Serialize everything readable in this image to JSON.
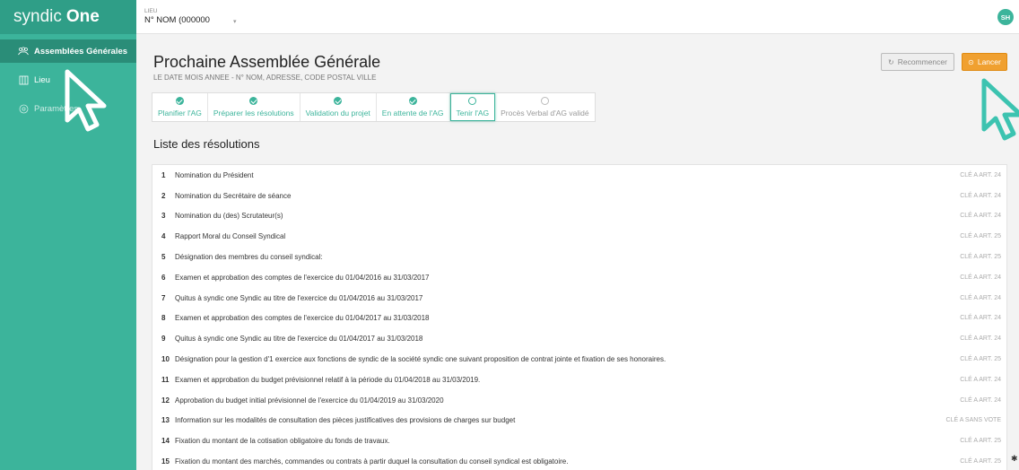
{
  "app": {
    "logo_light": "syndic",
    "logo_bold": "One"
  },
  "sidebar": {
    "items": [
      {
        "label": "Assemblées Générales",
        "icon": "people-icon"
      },
      {
        "label": "Lieu",
        "icon": "building-icon"
      },
      {
        "label": "Paramètres",
        "icon": "gear-icon"
      }
    ]
  },
  "topbar": {
    "lieu_label": "LIEU",
    "lieu_value": "N° NOM (000000",
    "user_initials": "SH"
  },
  "page": {
    "title": "Prochaine Assemblée Générale",
    "subtitle": "LE DATE MOIS ANNEE - N° NOM, ADRESSE, CODE POSTAL VILLE"
  },
  "actions": {
    "restart_label": "Recommencer",
    "launch_label": "Lancer"
  },
  "steps": [
    {
      "label": "Planifier l'AG",
      "state": "done"
    },
    {
      "label": "Préparer les résolutions",
      "state": "done"
    },
    {
      "label": "Validation du projet",
      "state": "done"
    },
    {
      "label": "En attente de l'AG",
      "state": "done"
    },
    {
      "label": "Tenir l'AG",
      "state": "current"
    },
    {
      "label": "Procès Verbal d'AG validé",
      "state": "todo"
    }
  ],
  "resolutions": {
    "title": "Liste des résolutions",
    "rows": [
      {
        "num": "1",
        "text": "Nomination du Président",
        "key": "CLÉ A  ART. 24"
      },
      {
        "num": "2",
        "text": "Nomination du Secrétaire de séance",
        "key": "CLÉ A  ART. 24"
      },
      {
        "num": "3",
        "text": "Nomination du (des) Scrutateur(s)",
        "key": "CLÉ A  ART. 24"
      },
      {
        "num": "4",
        "text": "Rapport Moral du Conseil Syndical",
        "key": "CLÉ A  ART. 25"
      },
      {
        "num": "5",
        "text": "Désignation des membres du conseil syndical:",
        "key": "CLÉ A  ART. 25"
      },
      {
        "num": "6",
        "text": "Examen et approbation des comptes de l'exercice du 01/04/2016 au 31/03/2017",
        "key": "CLÉ A  ART. 24"
      },
      {
        "num": "7",
        "text": "Quitus à syndic one Syndic au titre de l'exercice du 01/04/2016 au 31/03/2017",
        "key": "CLÉ A  ART. 24"
      },
      {
        "num": "8",
        "text": "Examen et approbation des comptes de l'exercice du 01/04/2017 au 31/03/2018",
        "key": "CLÉ A  ART. 24"
      },
      {
        "num": "9",
        "text": "Quitus à syndic one Syndic au titre de l'exercice du 01/04/2017 au 31/03/2018",
        "key": "CLÉ A  ART. 24"
      },
      {
        "num": "10",
        "text": "Désignation pour la gestion d'1 exercice aux fonctions de syndic de la société syndic one suivant proposition de contrat jointe et fixation de ses honoraires.",
        "key": "CLÉ A  ART. 25"
      },
      {
        "num": "11",
        "text": "Examen et approbation du budget prévisionnel relatif à la période du 01/04/2018 au 31/03/2019.",
        "key": "CLÉ A  ART. 24"
      },
      {
        "num": "12",
        "text": "Approbation du budget initial prévisionnel de l'exercice du 01/04/2019 au 31/03/2020",
        "key": "CLÉ A  ART. 24"
      },
      {
        "num": "13",
        "text": "Information sur les modalités de consultation des pièces justificatives des provisions de charges sur budget",
        "key": "CLÉ A  SANS VOTE"
      },
      {
        "num": "14",
        "text": "Fixation du montant de la cotisation obligatoire du fonds de travaux.",
        "key": "CLÉ A  ART. 25"
      },
      {
        "num": "15",
        "text": "Fixation du montant des marchés, commandes ou contrats à partir duquel la consultation du conseil syndical est obligatoire.",
        "key": "CLÉ A  ART. 25"
      }
    ]
  },
  "colors": {
    "brand": "#3cb49b",
    "sidebar_active": "#2a8d78",
    "launch": "#f0a030"
  }
}
